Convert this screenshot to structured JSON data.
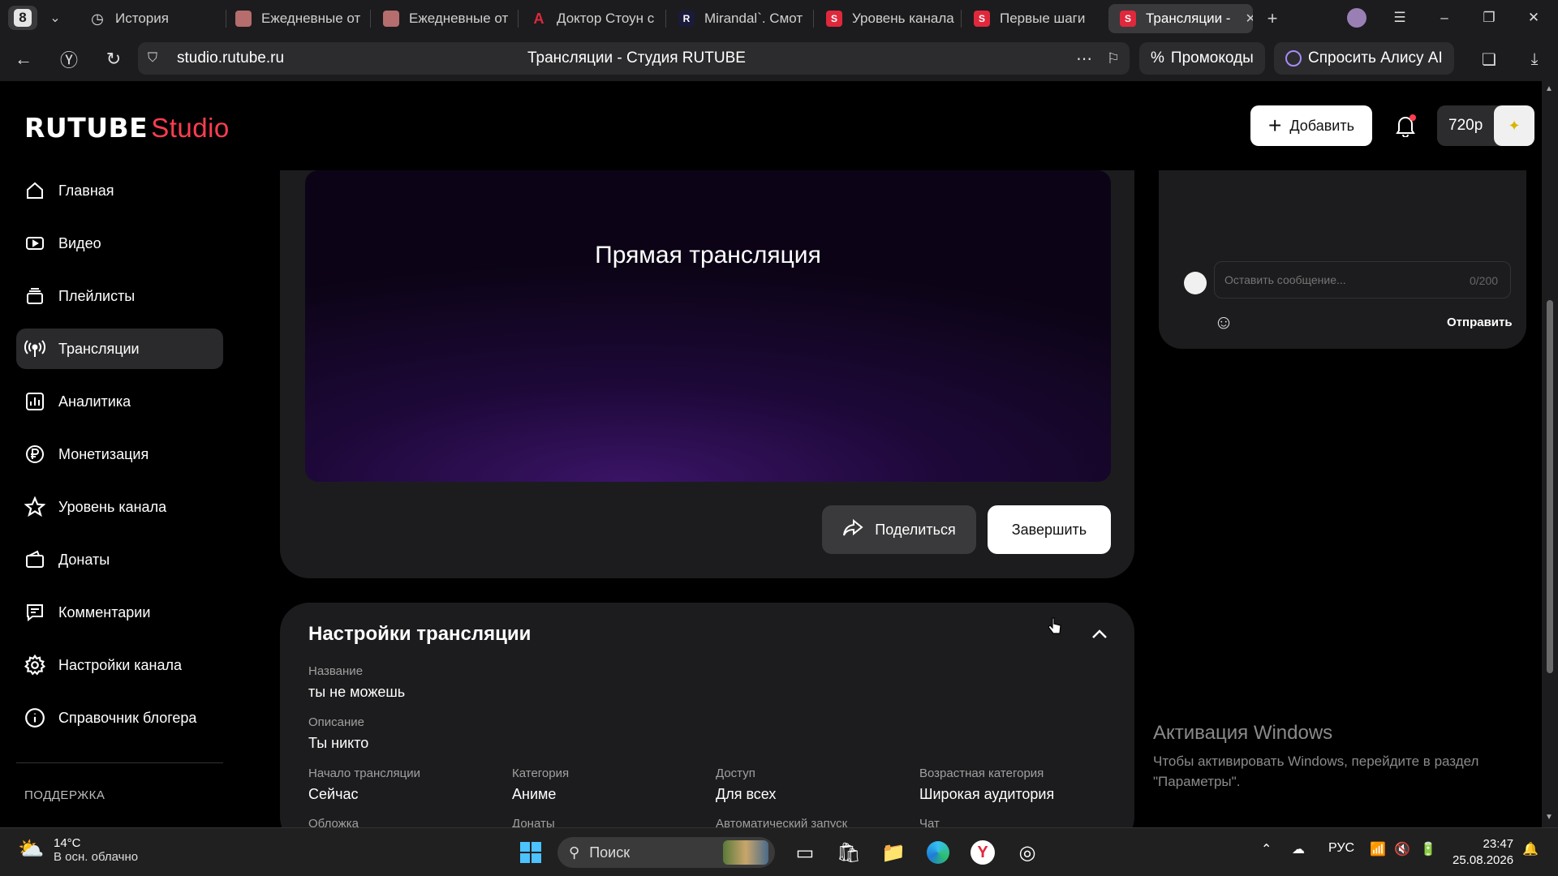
{
  "browser": {
    "tab_count": "8",
    "tabs": [
      {
        "label": "История",
        "color": "#2c2c2e"
      },
      {
        "label": "Ежедневные от",
        "color": "#c0392b"
      },
      {
        "label": "Ежедневные от",
        "color": "#c0392b"
      },
      {
        "label": "Доктор Стоун с",
        "color": "#e0283c"
      },
      {
        "label": "Mirandal`. Смот",
        "color": "#1a1a3a"
      },
      {
        "label": "Уровень канала",
        "color": "#e0283c"
      },
      {
        "label": "Первые шаги",
        "color": "#e0283c"
      },
      {
        "label": "Трансляции -",
        "color": "#e0283c"
      }
    ],
    "url": "studio.rutube.ru",
    "page_title": "Трансляции - Студия RUTUBE",
    "promo_label": "Промокоды",
    "alice_label": "Спросить Алису AI"
  },
  "header": {
    "logo_main": "RUTUBE",
    "logo_studio": "Studio",
    "add_label": "Добавить",
    "quality": "720p"
  },
  "sidebar": {
    "items": [
      {
        "label": "Главная",
        "icon": "home-icon"
      },
      {
        "label": "Видео",
        "icon": "video-icon"
      },
      {
        "label": "Плейлисты",
        "icon": "playlist-icon"
      },
      {
        "label": "Трансляции",
        "icon": "broadcast-icon"
      },
      {
        "label": "Аналитика",
        "icon": "analytics-icon"
      },
      {
        "label": "Монетизация",
        "icon": "ruble-icon"
      },
      {
        "label": "Уровень канала",
        "icon": "star-icon"
      },
      {
        "label": "Донаты",
        "icon": "wallet-icon"
      },
      {
        "label": "Комментарии",
        "icon": "comment-icon"
      },
      {
        "label": "Настройки канала",
        "icon": "gear-icon"
      },
      {
        "label": "Справочник блогера",
        "icon": "info-icon"
      }
    ],
    "active_index": 3,
    "support_label": "ПОДДЕРЖКА"
  },
  "player": {
    "title": "Прямая трансляция",
    "share_label": "Поделиться",
    "finish_label": "Завершить"
  },
  "settings": {
    "title": "Настройки трансляции",
    "name_label": "Название",
    "name_value": "ты не можешь",
    "desc_label": "Описание",
    "desc_value": "Ты никто",
    "start_label": "Начало трансляции",
    "start_value": "Сейчас",
    "category_label": "Категория",
    "category_value": "Аниме",
    "access_label": "Доступ",
    "access_value": "Для всех",
    "age_label": "Возрастная категория",
    "age_value": "Широкая аудитория",
    "cover_label": "Обложка",
    "donations_label": "Донаты",
    "autostart_label": "Автоматический запуск",
    "chat_label": "Чат"
  },
  "chat": {
    "placeholder": "Оставить сообщение...",
    "counter": "0/200",
    "send_label": "Отправить"
  },
  "windows_activation": {
    "title": "Активация Windows",
    "line1": "Чтобы активировать Windows, перейдите в раздел",
    "line2": "\"Параметры\"."
  },
  "taskbar": {
    "temp": "14°C",
    "weather": "В осн. облачно",
    "search_label": "Поиск",
    "lang": "РУС",
    "time": "23:47",
    "date": "25.08.2026"
  }
}
